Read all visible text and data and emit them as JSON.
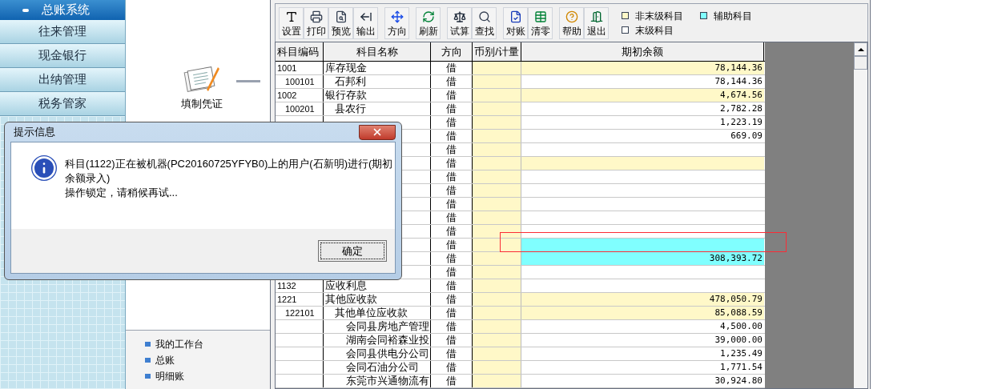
{
  "sidebar": {
    "header": "总账系统",
    "items": [
      "往来管理",
      "现金银行",
      "出纳管理",
      "税务管家"
    ]
  },
  "workspace": {
    "shortcut": "填制凭证",
    "links": [
      "我的工作台",
      "总账",
      "明细账"
    ]
  },
  "toolbar": {
    "groups": [
      [
        "设置",
        "打印",
        "预览",
        "输出"
      ],
      [
        "方向"
      ],
      [
        "刷新"
      ],
      [
        "试算",
        "查找"
      ],
      [
        "对账",
        "清零"
      ],
      [
        "帮助",
        "退出"
      ]
    ]
  },
  "legend": [
    {
      "label": "非末级科目",
      "color": "#fff8c8"
    },
    {
      "label": "辅助科目",
      "color": "#80ffff"
    },
    {
      "label": "末级科目",
      "color": "#ffffff"
    }
  ],
  "table": {
    "columns": [
      "科目编码",
      "科目名称",
      "方向",
      "币别/计量",
      "期初余额"
    ],
    "rows": [
      {
        "code": "1001",
        "name": "库存现金",
        "direction": "借",
        "amount": "78,144.36",
        "kind": "nonleaf",
        "selected": false,
        "children": [
          {
            "code": "100101",
            "name": "石邦利",
            "direction": "借",
            "amount": "78,144.36",
            "kind": "leaf",
            "selected": false
          }
        ]
      },
      {
        "code": "1002",
        "name": "银行存款",
        "direction": "借",
        "amount": "4,674.56",
        "kind": "nonleaf",
        "selected": false,
        "children": [
          {
            "code": "100201",
            "name": "县农行",
            "direction": "借",
            "amount": "2,782.28",
            "kind": "leaf",
            "selected": false
          }
        ]
      },
      {
        "direction": "借",
        "amount": "1,223.19",
        "kind": "leaf",
        "selected": false
      },
      {
        "direction": "借",
        "amount": "669.09",
        "kind": "leaf",
        "selected": false
      },
      {
        "direction": "借",
        "kind": "leaf",
        "selected": false
      },
      {
        "direction": "借",
        "kind": "nonleaf",
        "selected": false
      },
      {
        "direction": "借",
        "kind": "leaf",
        "selected": false
      },
      {
        "direction": "借",
        "kind": "leaf",
        "selected": false
      },
      {
        "direction": "借",
        "kind": "leaf",
        "selected": false
      },
      {
        "direction": "借",
        "kind": "leaf",
        "selected": false
      },
      {
        "direction": "借",
        "kind": "leaf",
        "selected": false
      },
      {
        "direction": "借",
        "kind": "aux",
        "selected": true
      },
      {
        "direction": "借",
        "amount": "308,393.72",
        "kind": "aux",
        "selected": false
      },
      {
        "direction": "借",
        "kind": "leaf",
        "selected": false
      },
      {
        "code": "1132",
        "name": "应收利息",
        "direction": "借",
        "kind": "leaf",
        "selected": false
      },
      {
        "code": "1221",
        "name": "其他应收款",
        "direction": "借",
        "amount": "478,050.79",
        "kind": "nonleaf",
        "selected": false,
        "children": [
          {
            "code": "122101",
            "name": "其他单位应收款",
            "direction": "借",
            "amount": "85,088.59",
            "kind": "nonleaf",
            "selected": false,
            "children": [
              {
                "name": "会同县房地产管理",
                "direction": "借",
                "amount": "4,500.00",
                "kind": "leaf",
                "selected": false
              },
              {
                "name": "湖南会同裕森业投",
                "direction": "借",
                "amount": "39,000.00",
                "kind": "leaf",
                "selected": false
              },
              {
                "name": "会同县供电分公司",
                "direction": "借",
                "amount": "1,235.49",
                "kind": "leaf",
                "selected": false
              },
              {
                "name": "会同石油分公司",
                "direction": "借",
                "amount": "1,771.54",
                "kind": "leaf",
                "selected": false
              },
              {
                "name": "东莞市兴通物流有",
                "direction": "借",
                "amount": "30,924.80",
                "kind": "leaf",
                "selected": false
              }
            ]
          }
        ]
      }
    ]
  },
  "dialog": {
    "title": "提示信息",
    "lines": [
      "科目(1122)正在被机器(PC20160725YFYB0)上的用户(石新明)进行(期初",
      "余额录入)",
      "操作锁定，请稍候再试..."
    ],
    "button": "确定"
  }
}
